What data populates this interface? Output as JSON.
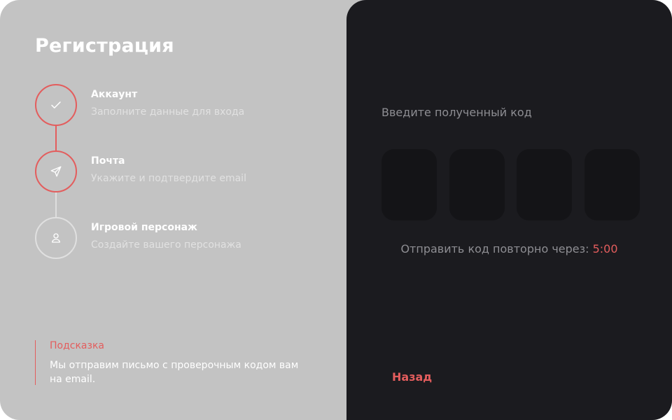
{
  "page": {
    "title": "Регистрация"
  },
  "steps": [
    {
      "title": "Аккаунт",
      "subtitle": "Заполните данные для входа",
      "icon": "check-icon",
      "state": "done"
    },
    {
      "title": "Почта",
      "subtitle": "Укажите и подтвердите email",
      "icon": "send-icon",
      "state": "active"
    },
    {
      "title": "Игровой персонаж",
      "subtitle": "Создайте вашего персонажа",
      "icon": "user-icon",
      "state": "pending"
    }
  ],
  "hint": {
    "title": "Подсказка",
    "text": "Мы отправим письмо с проверочным кодом вам на email."
  },
  "verification": {
    "label": "Введите полученный код",
    "code_values": [
      "",
      "",
      "",
      ""
    ],
    "resend_text": "Отправить код повторно через:",
    "timer": "5:00"
  },
  "actions": {
    "back_label": "Назад"
  },
  "colors": {
    "accent": "#e35d5d",
    "left_bg": "#c3c3c3",
    "right_bg": "#1b1b1f",
    "input_bg": "#141417"
  }
}
